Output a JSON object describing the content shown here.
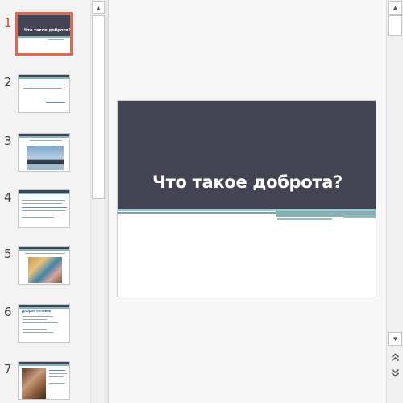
{
  "slides": [
    {
      "number": "1",
      "title": "Что такое доброта?"
    },
    {
      "number": "2"
    },
    {
      "number": "3"
    },
    {
      "number": "4"
    },
    {
      "number": "5"
    },
    {
      "number": "6",
      "heading": "Доброе человек"
    },
    {
      "number": "7"
    }
  ],
  "main_slide": {
    "title": "Что такое доброта?"
  },
  "colors": {
    "slide_dark": "#434353",
    "accent_teal": "#7fb9c0",
    "selection": "#e0684b"
  },
  "icons": {
    "scroll_up": "▲",
    "scroll_down": "▼",
    "prev_slide": "double-chevron-up-icon",
    "next_slide": "double-chevron-down-icon"
  }
}
